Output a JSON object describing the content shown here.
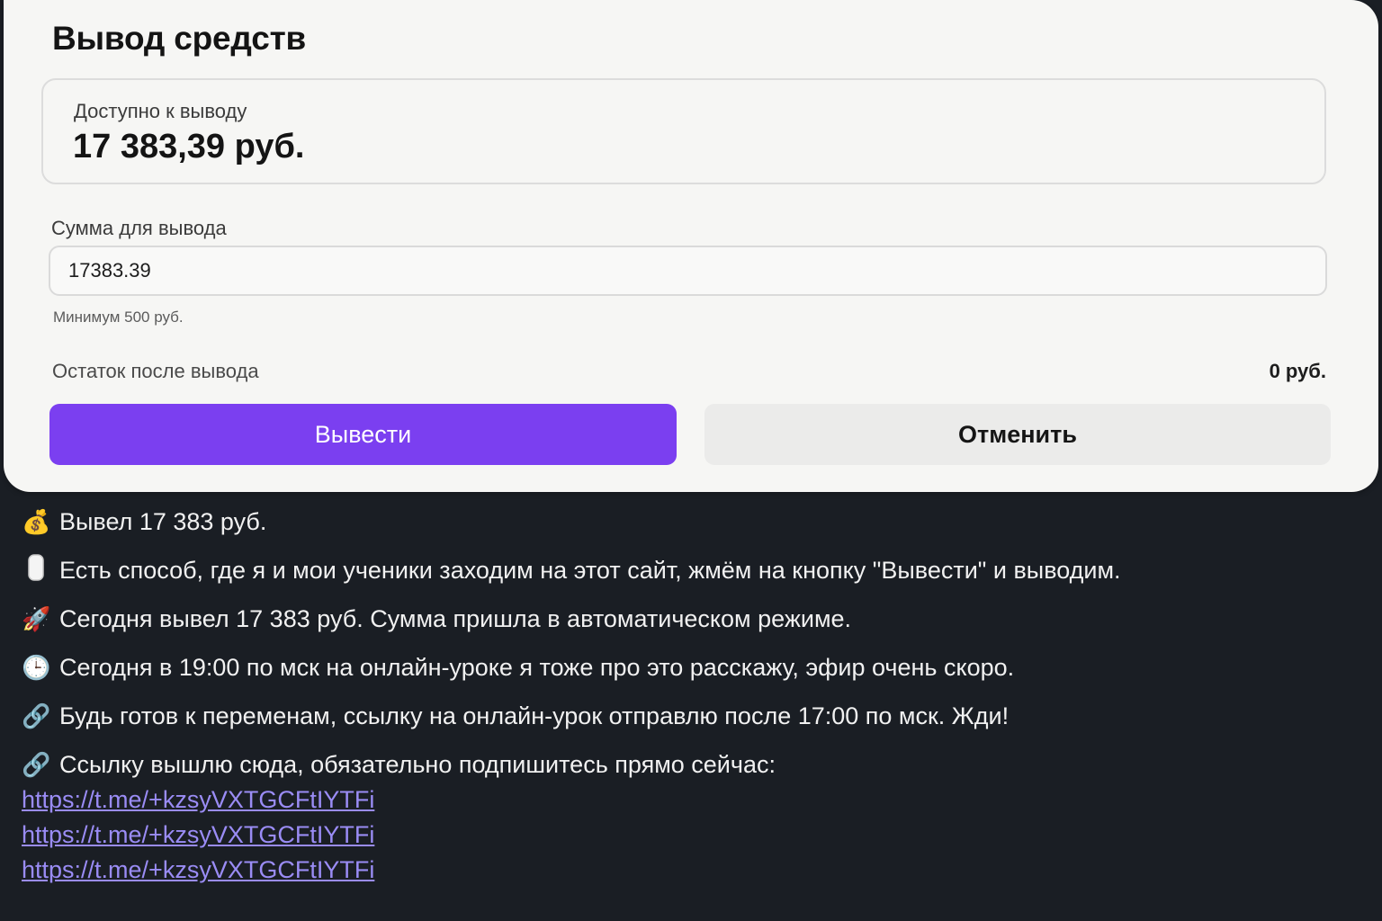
{
  "withdraw": {
    "title": "Вывод средств",
    "available_label": "Доступно к выводу",
    "available_value": "17 383,39 руб.",
    "amount_label": "Сумма для вывода",
    "amount_value": "17383.39",
    "min_hint": "Минимум 500 руб.",
    "rest_label": "Остаток после вывода",
    "rest_value": "0 руб.",
    "withdraw_button": "Вывести",
    "cancel_button": "Отменить"
  },
  "colors": {
    "accent": "#7b3ff0",
    "link": "#9a8cf5",
    "dark_background": "#1a1e24"
  },
  "messages": [
    {
      "icon": "money-bag-icon",
      "glyph": "💰",
      "text": "Вывел 17 383 руб."
    },
    {
      "icon": "white-pill-icon",
      "glyph": "▮",
      "text": "Есть способ, где я и мои ученики заходим на этот сайт, жмём на кнопку \"Вывести\" и выводим."
    },
    {
      "icon": "rocket-icon",
      "glyph": "🚀",
      "text": "Сегодня вывел 17 383 руб. Сумма пришла в автоматическом режиме."
    },
    {
      "icon": "clock-icon",
      "glyph": "🕒",
      "text": "Сегодня в 19:00 по мск на онлайн-уроке я тоже про это расскажу, эфир очень скоро."
    },
    {
      "icon": "link-icon",
      "glyph": "🔗",
      "text": "Будь готов к переменам, ссылку на онлайн-урок отправлю после 17:00 по мск. Жди!"
    },
    {
      "icon": "link-icon",
      "glyph": "🔗",
      "text": "Ссылку вышлю сюда, обязательно подпишитесь прямо сейчас:"
    }
  ],
  "links": [
    "https://t.me/+kzsyVXTGCFtIYTFi",
    "https://t.me/+kzsyVXTGCFtIYTFi",
    "https://t.me/+kzsyVXTGCFtIYTFi"
  ]
}
